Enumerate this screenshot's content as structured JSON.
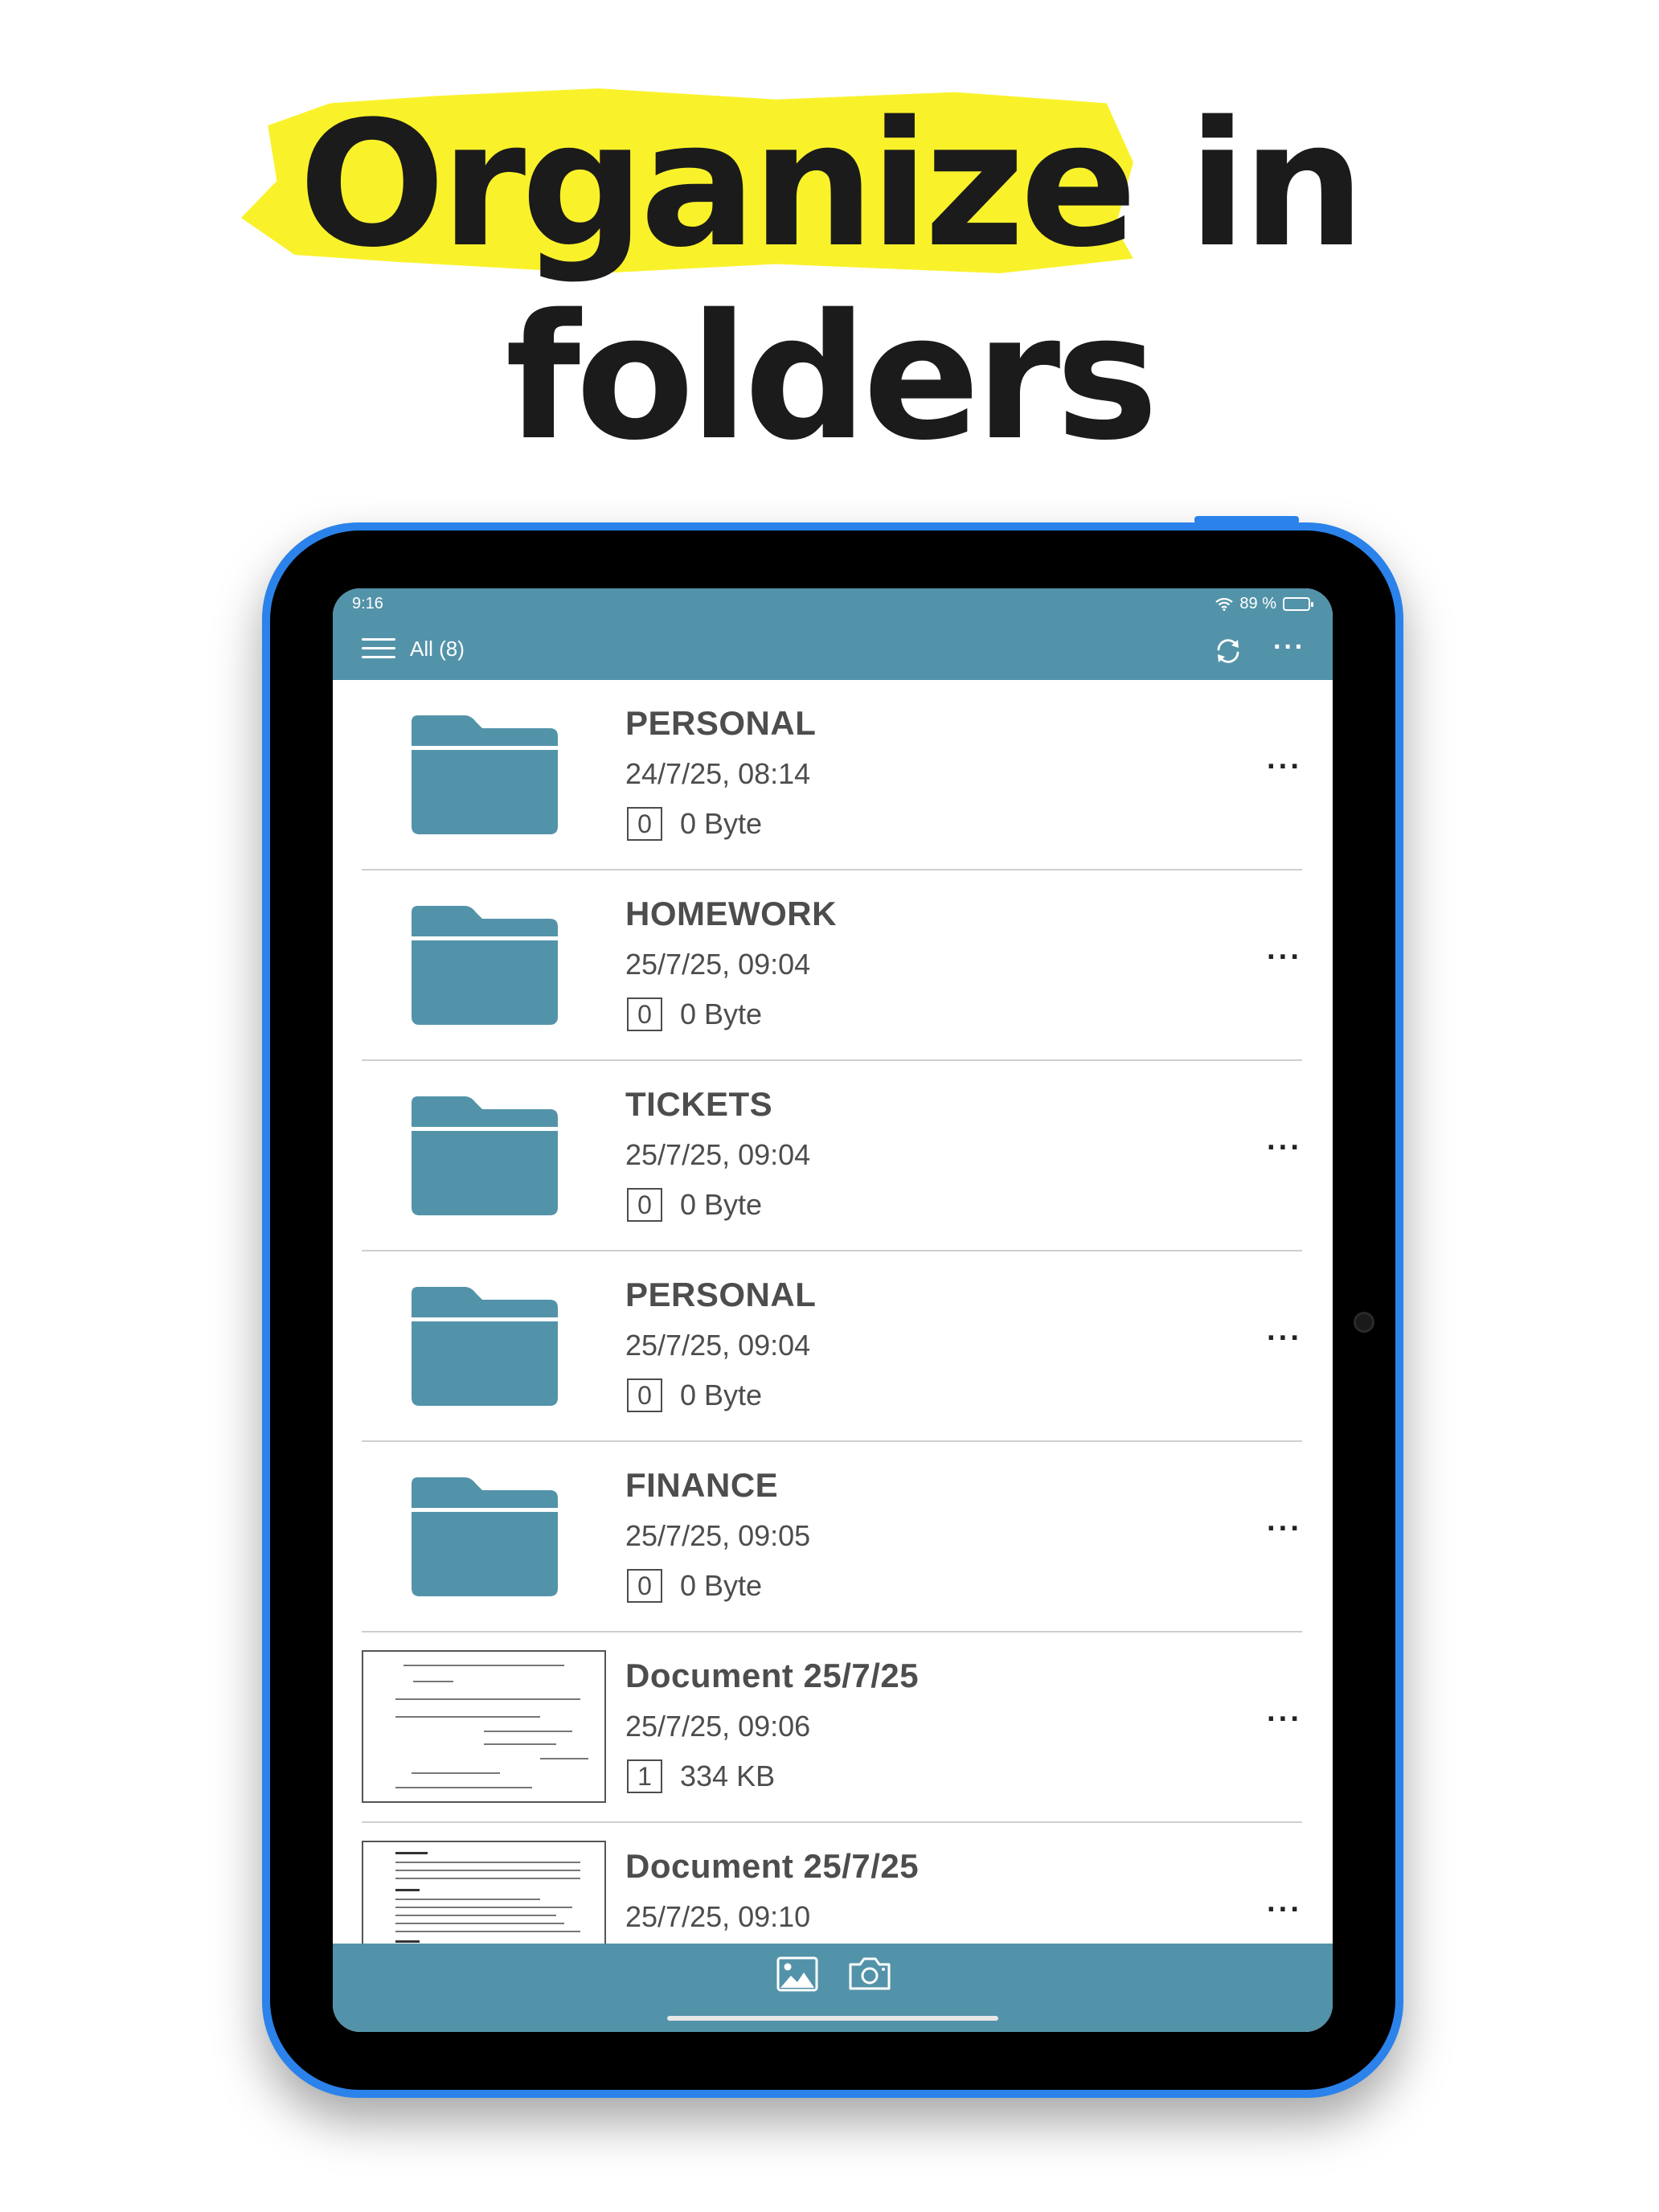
{
  "headline": {
    "line1": "Organize in",
    "line2": "folders"
  },
  "status": {
    "time": "9:16",
    "battery": "89 %"
  },
  "appbar": {
    "title": "All (8)",
    "menu_icon": "hamburger-icon",
    "sync_icon": "sync-icon",
    "more_icon": "more-icon"
  },
  "items": [
    {
      "name": "PERSONAL",
      "date": "24/7/25, 08:14",
      "count": "0",
      "size": "0 Byte",
      "type": "folder"
    },
    {
      "name": "HOMEWORK",
      "date": "25/7/25, 09:04",
      "count": "0",
      "size": "0 Byte",
      "type": "folder"
    },
    {
      "name": "TICKETS",
      "date": "25/7/25, 09:04",
      "count": "0",
      "size": "0 Byte",
      "type": "folder"
    },
    {
      "name": "PERSONAL",
      "date": "25/7/25, 09:04",
      "count": "0",
      "size": "0 Byte",
      "type": "folder"
    },
    {
      "name": "FINANCE",
      "date": "25/7/25, 09:05",
      "count": "0",
      "size": "0 Byte",
      "type": "folder"
    },
    {
      "name": "Document 25/7/25",
      "date": "25/7/25, 09:06",
      "count": "1",
      "size": "334 KB",
      "type": "document"
    },
    {
      "name": "Document 25/7/25",
      "date": "25/7/25, 09:10",
      "type": "document"
    }
  ],
  "bottombar": {
    "gallery_icon": "gallery-icon",
    "camera_icon": "camera-icon"
  },
  "colors": {
    "accent": "#5393a9",
    "highlight": "#f9f22b",
    "device": "#2b82ea",
    "text": "#4d4d4d"
  }
}
